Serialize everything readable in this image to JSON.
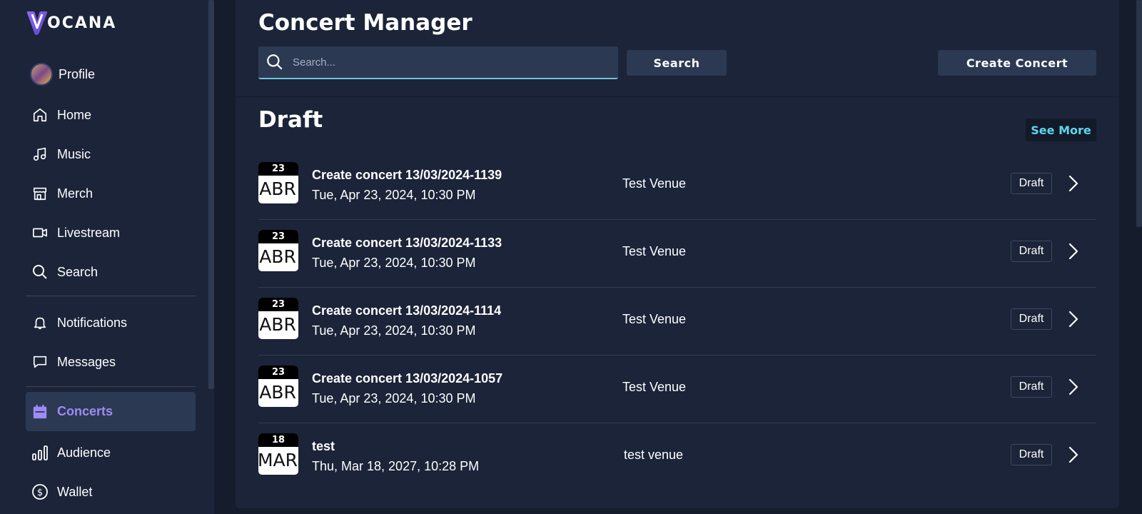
{
  "brand": {
    "logo_text": "OCANA"
  },
  "sidebar": {
    "profile": {
      "label": "Profile"
    },
    "items": [
      {
        "label": "Home",
        "icon": "home-icon"
      },
      {
        "label": "Music",
        "icon": "music-note-icon"
      },
      {
        "label": "Merch",
        "icon": "store-icon"
      },
      {
        "label": "Livestream",
        "icon": "video-camera-icon"
      },
      {
        "label": "Search",
        "icon": "search-icon"
      },
      {
        "label": "Notifications",
        "icon": "bell-icon"
      },
      {
        "label": "Messages",
        "icon": "chat-icon"
      },
      {
        "label": "Concerts",
        "icon": "calendar-icon",
        "active": true
      },
      {
        "label": "Audience",
        "icon": "bar-chart-icon"
      },
      {
        "label": "Wallet",
        "icon": "dollar-circle-icon"
      }
    ]
  },
  "header": {
    "title": "Concert Manager",
    "search_placeholder": "Search...",
    "search_value": "",
    "search_button": "Search",
    "create_button": "Create Concert"
  },
  "draft": {
    "title": "Draft",
    "see_more": "See More",
    "concerts": [
      {
        "day": "23",
        "month": "ABR",
        "title": "Create concert 13/03/2024-1139",
        "date": "Tue, Apr 23, 2024, 10:30 PM",
        "venue": "Test Venue",
        "status": "Draft"
      },
      {
        "day": "23",
        "month": "ABR",
        "title": "Create concert 13/03/2024-1133",
        "date": "Tue, Apr 23, 2024, 10:30 PM",
        "venue": "Test Venue",
        "status": "Draft"
      },
      {
        "day": "23",
        "month": "ABR",
        "title": "Create concert 13/03/2024-1114",
        "date": "Tue, Apr 23, 2024, 10:30 PM",
        "venue": "Test Venue",
        "status": "Draft"
      },
      {
        "day": "23",
        "month": "ABR",
        "title": "Create concert 13/03/2024-1057",
        "date": "Tue, Apr 23, 2024, 10:30 PM",
        "venue": "Test Venue",
        "status": "Draft"
      },
      {
        "day": "18",
        "month": "MAR",
        "title": "test",
        "date": "Thu, Mar 18, 2027, 10:28 PM",
        "venue": "test venue",
        "status": "Draft"
      }
    ]
  },
  "colors": {
    "accent": "#9f8af5",
    "link": "#5fd6e8",
    "background": "#1b2438"
  }
}
